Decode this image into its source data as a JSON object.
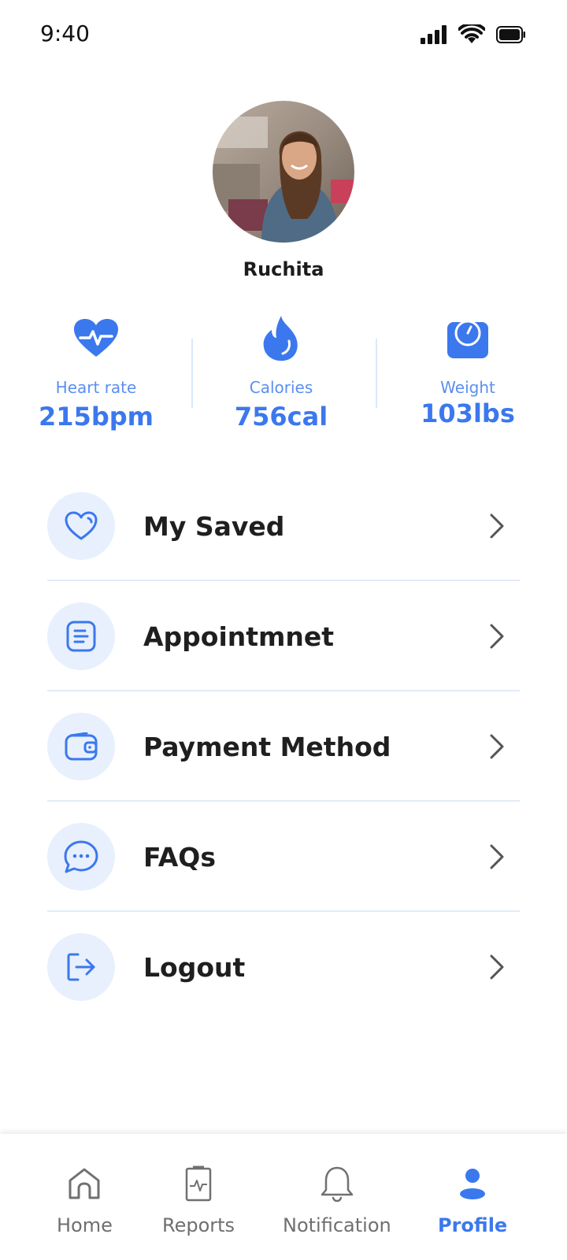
{
  "status_bar": {
    "time": "9:40",
    "icons": [
      "signal-icon",
      "wifi-icon",
      "battery-icon"
    ]
  },
  "profile": {
    "name": "Ruchita",
    "avatar_icon": "user-photo"
  },
  "stats": [
    {
      "icon": "heart-pulse-icon",
      "label": "Heart rate",
      "value": "215bpm"
    },
    {
      "icon": "flame-icon",
      "label": "Calories",
      "value": "756cal"
    },
    {
      "icon": "scale-icon",
      "label": "Weight",
      "value": "103lbs"
    }
  ],
  "menu": [
    {
      "icon": "heart-icon",
      "label": "My Saved"
    },
    {
      "icon": "document-icon",
      "label": "Appointmnet"
    },
    {
      "icon": "wallet-icon",
      "label": "Payment Method"
    },
    {
      "icon": "chat-icon",
      "label": "FAQs"
    },
    {
      "icon": "logout-icon",
      "label": "Logout"
    }
  ],
  "bottom_nav": [
    {
      "icon": "home-icon",
      "label": "Home",
      "active": false
    },
    {
      "icon": "reports-icon",
      "label": "Reports",
      "active": false
    },
    {
      "icon": "bell-icon",
      "label": "Notification",
      "active": false
    },
    {
      "icon": "profile-icon",
      "label": "Profile",
      "active": true
    }
  ],
  "colors": {
    "accent": "#3b78ee",
    "accent_light": "#e8f0fd",
    "text": "#1f1f1f",
    "muted": "#6f6f6f"
  }
}
